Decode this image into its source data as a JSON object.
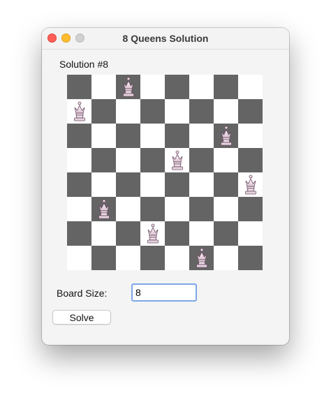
{
  "window": {
    "title": "8 Queens Solution"
  },
  "solution_label": "Solution #8",
  "board": {
    "size": 8,
    "queen_columns_by_row": [
      2,
      0,
      6,
      4,
      7,
      1,
      3,
      5
    ],
    "dark_color": "#646464",
    "light_color": "#ffffff",
    "piece_icon": "queen-icon"
  },
  "controls": {
    "board_size_label": "Board Size:",
    "board_size_value": "8",
    "solve_label": "Solve"
  }
}
